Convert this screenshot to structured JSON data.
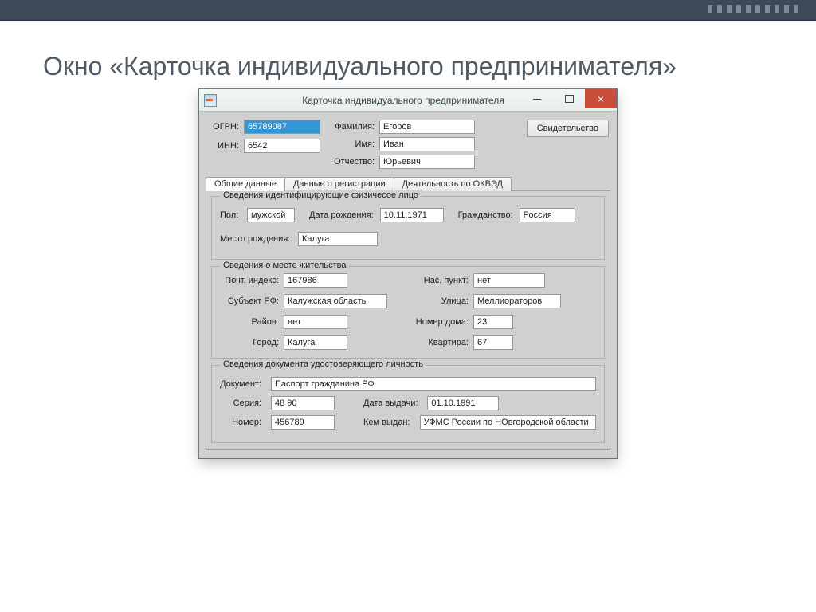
{
  "slide": {
    "heading": "Окно «Карточка индивидуального предпринимателя»"
  },
  "window": {
    "title": "Карточка индивидуального предпринимателя"
  },
  "header": {
    "ogrn_label": "ОГРН:",
    "ogrn_value": "65789087",
    "inn_label": "ИНН:",
    "inn_value": "6542",
    "lastname_label": "Фамилия:",
    "lastname_value": "Егоров",
    "firstname_label": "Имя:",
    "firstname_value": "Иван",
    "patronymic_label": "Отчество:",
    "patronymic_value": "Юрьевич",
    "cert_button": "Свидетельство"
  },
  "tabs": {
    "general": "Общие данные",
    "registration": "Данные о регистрации",
    "okved": "Деятельность по ОКВЭД"
  },
  "group_identity": {
    "title": "Сведения идентифицирующие физичесое лицо",
    "sex_label": "Пол:",
    "sex_value": "мужской",
    "dob_label": "Дата рождения:",
    "dob_value": "10.11.1971",
    "citizenship_label": "Гражданство:",
    "citizenship_value": "Россия",
    "pob_label": "Место рождения:",
    "pob_value": "Калуга"
  },
  "group_address": {
    "title": "Сведения о месте жительства",
    "zip_label": "Почт. индекс:",
    "zip_value": "167986",
    "region_label": "Субъект РФ:",
    "region_value": "Калужская область",
    "district_label": "Район:",
    "district_value": "нет",
    "city_label": "Город:",
    "city_value": "Калуга",
    "town_label": "Нас. пункт:",
    "town_value": "нет",
    "street_label": "Улица:",
    "street_value": "Меллиораторов",
    "house_label": "Номер дома:",
    "house_value": "23",
    "flat_label": "Квартира:",
    "flat_value": "67"
  },
  "group_doc": {
    "title": "Сведения документа удостоверяющего личность",
    "doc_label": "Документ:",
    "doc_value": "Паспорт гражданина РФ",
    "series_label": "Серия:",
    "series_value": "48 90",
    "issue_label": "Дата выдачи:",
    "issue_value": "01.10.1991",
    "number_label": "Номер:",
    "number_value": "456789",
    "issuer_label": "Кем выдан:",
    "issuer_value": "УФМС России по НОвгородской области"
  }
}
